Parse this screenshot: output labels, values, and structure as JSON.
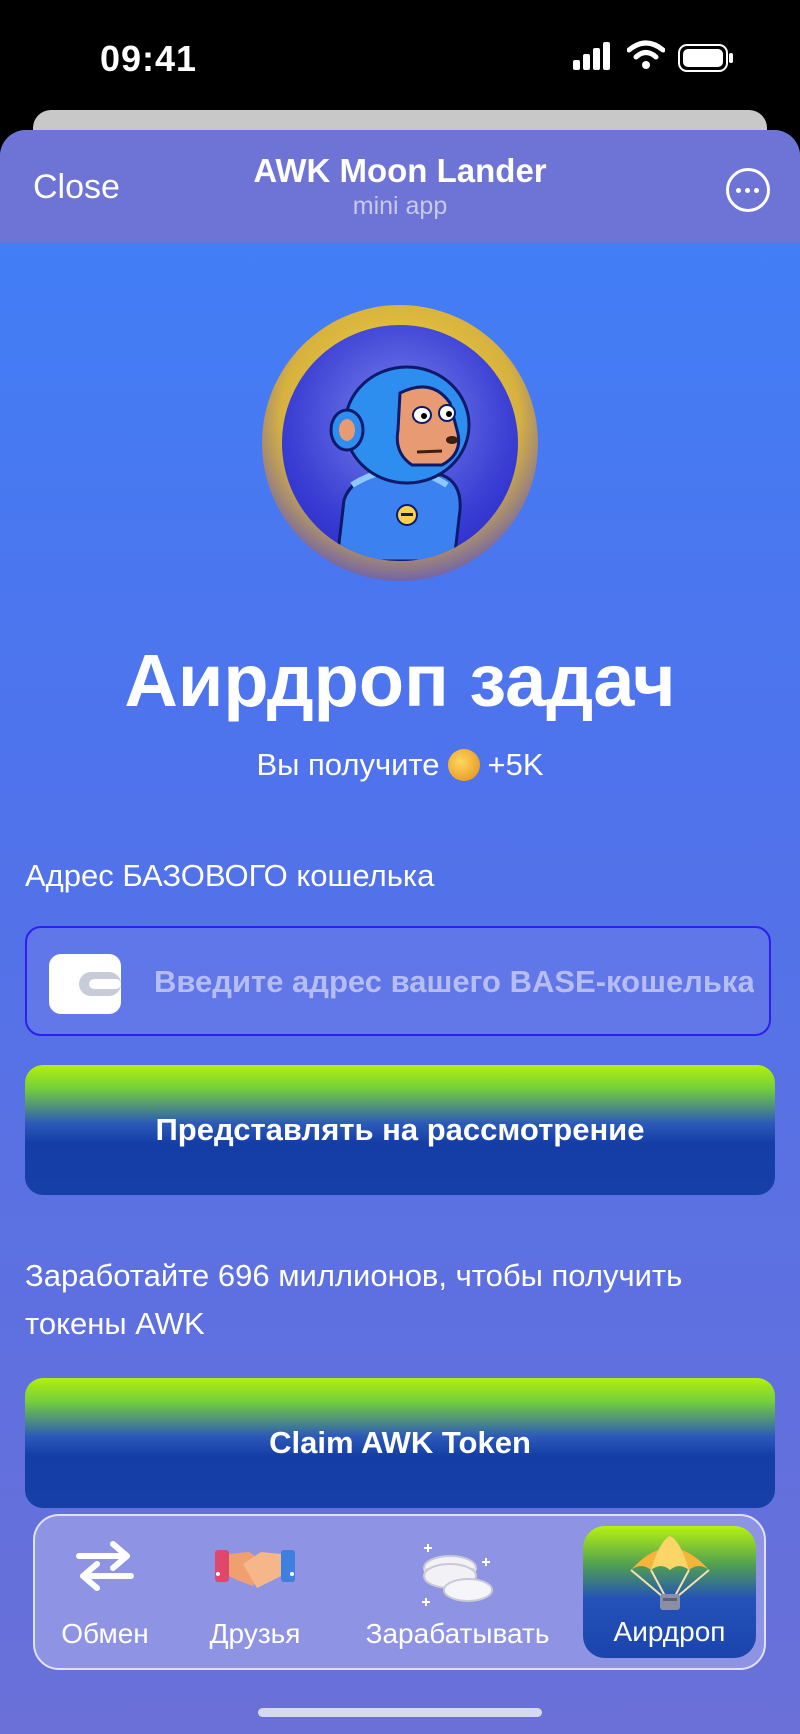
{
  "status_bar": {
    "time": "09:41"
  },
  "header": {
    "close_label": "Close",
    "title": "AWK Moon Lander",
    "subtitle": "mini app"
  },
  "hero": {
    "heading": "Аирдроп задач",
    "reward_prefix": "Вы получите",
    "reward_amount": "+5K"
  },
  "wallet": {
    "label": "Адрес БАЗОВОГО кошелька",
    "placeholder": "Введите адрес вашего BASE-кошелька",
    "value": ""
  },
  "submit_button": {
    "label": "Представлять на рассмотрение"
  },
  "earn_info": {
    "text": "Заработайте 696 миллионов, чтобы получить токены AWK"
  },
  "claim_button": {
    "label": "Claim AWK Token"
  },
  "tabs": [
    {
      "label": "Обмен",
      "icon": "exchange-arrows-icon",
      "active": false
    },
    {
      "label": "Друзья",
      "icon": "handshake-icon",
      "active": false
    },
    {
      "label": "Зарабатывать",
      "icon": "coins-stack-icon",
      "active": false
    },
    {
      "label": "Аирдроп",
      "icon": "parachute-icon",
      "active": true
    }
  ],
  "colors": {
    "accent_green": "#b3f00f",
    "button_blue": "#163fa8",
    "background_blue": "#3f80f8",
    "header_purple": "#6e73d6",
    "input_border": "#2c1ff0"
  }
}
